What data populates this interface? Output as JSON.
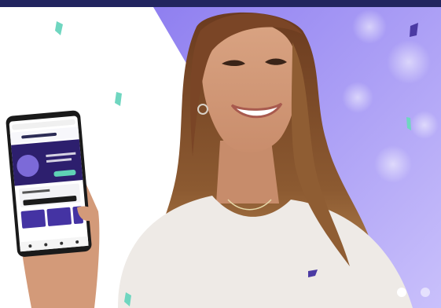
{
  "carousel": {
    "slide_count": 2,
    "active_index": 0
  },
  "colors": {
    "top_bar": "#22255f",
    "purple_bg": "#9a8cf0",
    "confetti_mint": "#6fd6c0",
    "confetti_purple": "#4b3aa3"
  },
  "icons": {
    "carousel_dot": "circle"
  }
}
